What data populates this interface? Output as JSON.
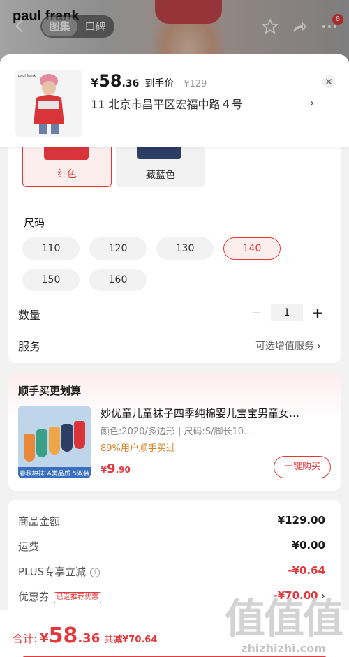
{
  "background": {
    "brand": "paul frank",
    "tabs": [
      {
        "label": "图集",
        "active": true
      },
      {
        "label": "口碑",
        "active": false
      }
    ],
    "cart_badge": "8",
    "icons": [
      "back-icon",
      "star-icon",
      "share-icon",
      "more-icon"
    ]
  },
  "header": {
    "currency": "¥",
    "price_int": "58",
    "price_dec": ".36",
    "price_tag": "到手价",
    "original_price": "¥129",
    "address": "11  北京市昌平区宏福中路４号"
  },
  "colors": [
    {
      "label": "红色",
      "selected": true,
      "swatch": "#d9343a"
    },
    {
      "label": "藏蓝色",
      "selected": false,
      "swatch": "#2c3d66"
    }
  ],
  "size_section": {
    "title": "尺码",
    "options": [
      {
        "label": "110",
        "selected": false
      },
      {
        "label": "120",
        "selected": false
      },
      {
        "label": "130",
        "selected": false
      },
      {
        "label": "140",
        "selected": true
      },
      {
        "label": "150",
        "selected": false
      },
      {
        "label": "160",
        "selected": false
      }
    ]
  },
  "quantity": {
    "label": "数量",
    "value": "1",
    "minus": "−",
    "plus": "+"
  },
  "service": {
    "label": "服务",
    "value": "可选增值服务"
  },
  "bundle": {
    "title": "顺手买更划算",
    "name": "妙优童儿童袜子四季纯棉婴儿宝宝男童女…",
    "spec": "颜色:2020/多边形  |  尺码:S/脚长10...",
    "bought": "89%用户顺手买过",
    "currency": "¥",
    "price_int": "9",
    "price_dec": ".90",
    "buy_label": "一键购买",
    "thumb_tags": [
      "春秋棉袜",
      "A类品质",
      "5双装"
    ]
  },
  "summary": {
    "rows": [
      {
        "label": "商品金额",
        "value": "¥129.00"
      },
      {
        "label": "运费",
        "value": "¥0.00"
      },
      {
        "label": "PLUS专享立减",
        "value": "-¥0.64"
      },
      {
        "label": "优惠券",
        "value": "-¥70.00",
        "tag": "已选推荐优惠"
      }
    ]
  },
  "footer": {
    "label": "合计:",
    "currency": "¥",
    "total_int": "58",
    "total_dec": ".36",
    "savings": "共减¥70.64"
  },
  "watermark": {
    "glyphs": "值值值",
    "url": "zhizhizhi.com"
  },
  "accent_color": "#e4393c"
}
